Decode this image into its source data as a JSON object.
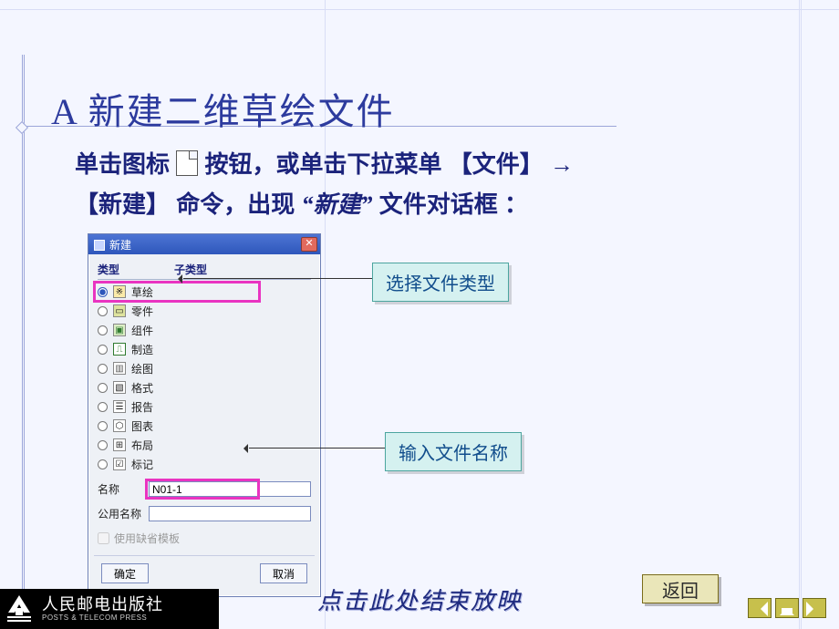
{
  "title": "A  新建二维草绘文件",
  "intro": {
    "part1": "单击图标 ",
    "part2": "按钮，或单击下拉菜单",
    "menu1": "【文件】",
    "arrow": "→",
    "menu2": "【新建】",
    "part3": "命令，出现",
    "quote_open": "“",
    "emph": "新建",
    "quote_close": "”",
    "part4": "文件对话框 ："
  },
  "dialog": {
    "title": "新建",
    "group_type": "类型",
    "group_subtype": "子类型",
    "types": [
      {
        "label": "草绘",
        "checked": true
      },
      {
        "label": "零件",
        "checked": false
      },
      {
        "label": "组件",
        "checked": false
      },
      {
        "label": "制造",
        "checked": false
      },
      {
        "label": "绘图",
        "checked": false
      },
      {
        "label": "格式",
        "checked": false
      },
      {
        "label": "报告",
        "checked": false
      },
      {
        "label": "图表",
        "checked": false
      },
      {
        "label": "布局",
        "checked": false
      },
      {
        "label": "标记",
        "checked": false
      }
    ],
    "name_label": "名称",
    "name_value": "N01-1",
    "common_name_label": "公用名称",
    "common_name_value": "",
    "use_default_template": "使用缺省模板",
    "ok": "确定",
    "cancel": "取消"
  },
  "callouts": {
    "select_type": "选择文件类型",
    "enter_name": "输入文件名称"
  },
  "footer": {
    "end_text": "点击此处结束放映",
    "back_button": "返回"
  },
  "publisher": {
    "cn": "人民邮电出版社",
    "en": "POSTS & TELECOM PRESS"
  }
}
